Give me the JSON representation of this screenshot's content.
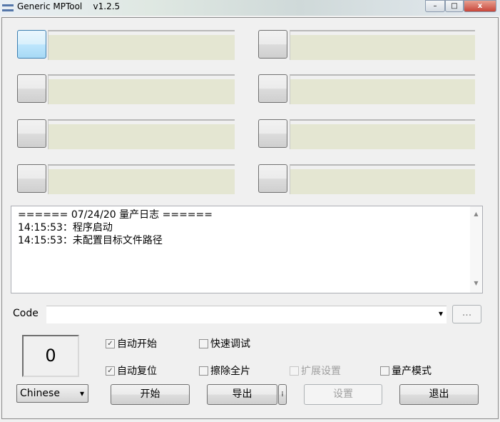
{
  "window": {
    "title": "Generic MPTool",
    "version": "v1.2.5",
    "minimize": "–",
    "maximize": "□",
    "close": "x"
  },
  "ports": [
    {},
    {},
    {},
    {},
    {},
    {},
    {},
    {}
  ],
  "log": {
    "lines": [
      "====== 07/24/20 量产日志 ======",
      "14:15:53：程序启动",
      "14:15:53：未配置目标文件路径"
    ],
    "scroll_up": "▲",
    "scroll_down": "▼"
  },
  "code": {
    "label": "Code",
    "value": "",
    "browse_label": "...",
    "dropdown": "▾"
  },
  "counter": "0",
  "checkboxes": {
    "auto_start": {
      "label": "自动开始",
      "checked": true
    },
    "quick_debug": {
      "label": "快速调试",
      "checked": false
    },
    "auto_reset": {
      "label": "自动复位",
      "checked": true
    },
    "erase_all": {
      "label": "擦除全片",
      "checked": false
    },
    "ext_settings": {
      "label": "扩展设置",
      "checked": false
    },
    "mp_mode": {
      "label": "量产模式",
      "checked": false
    }
  },
  "language": {
    "selected": "Chinese",
    "arrow": "▾"
  },
  "buttons": {
    "start": "开始",
    "export": "导出",
    "export_more": "⁞",
    "settings": "设置",
    "exit": "退出"
  }
}
